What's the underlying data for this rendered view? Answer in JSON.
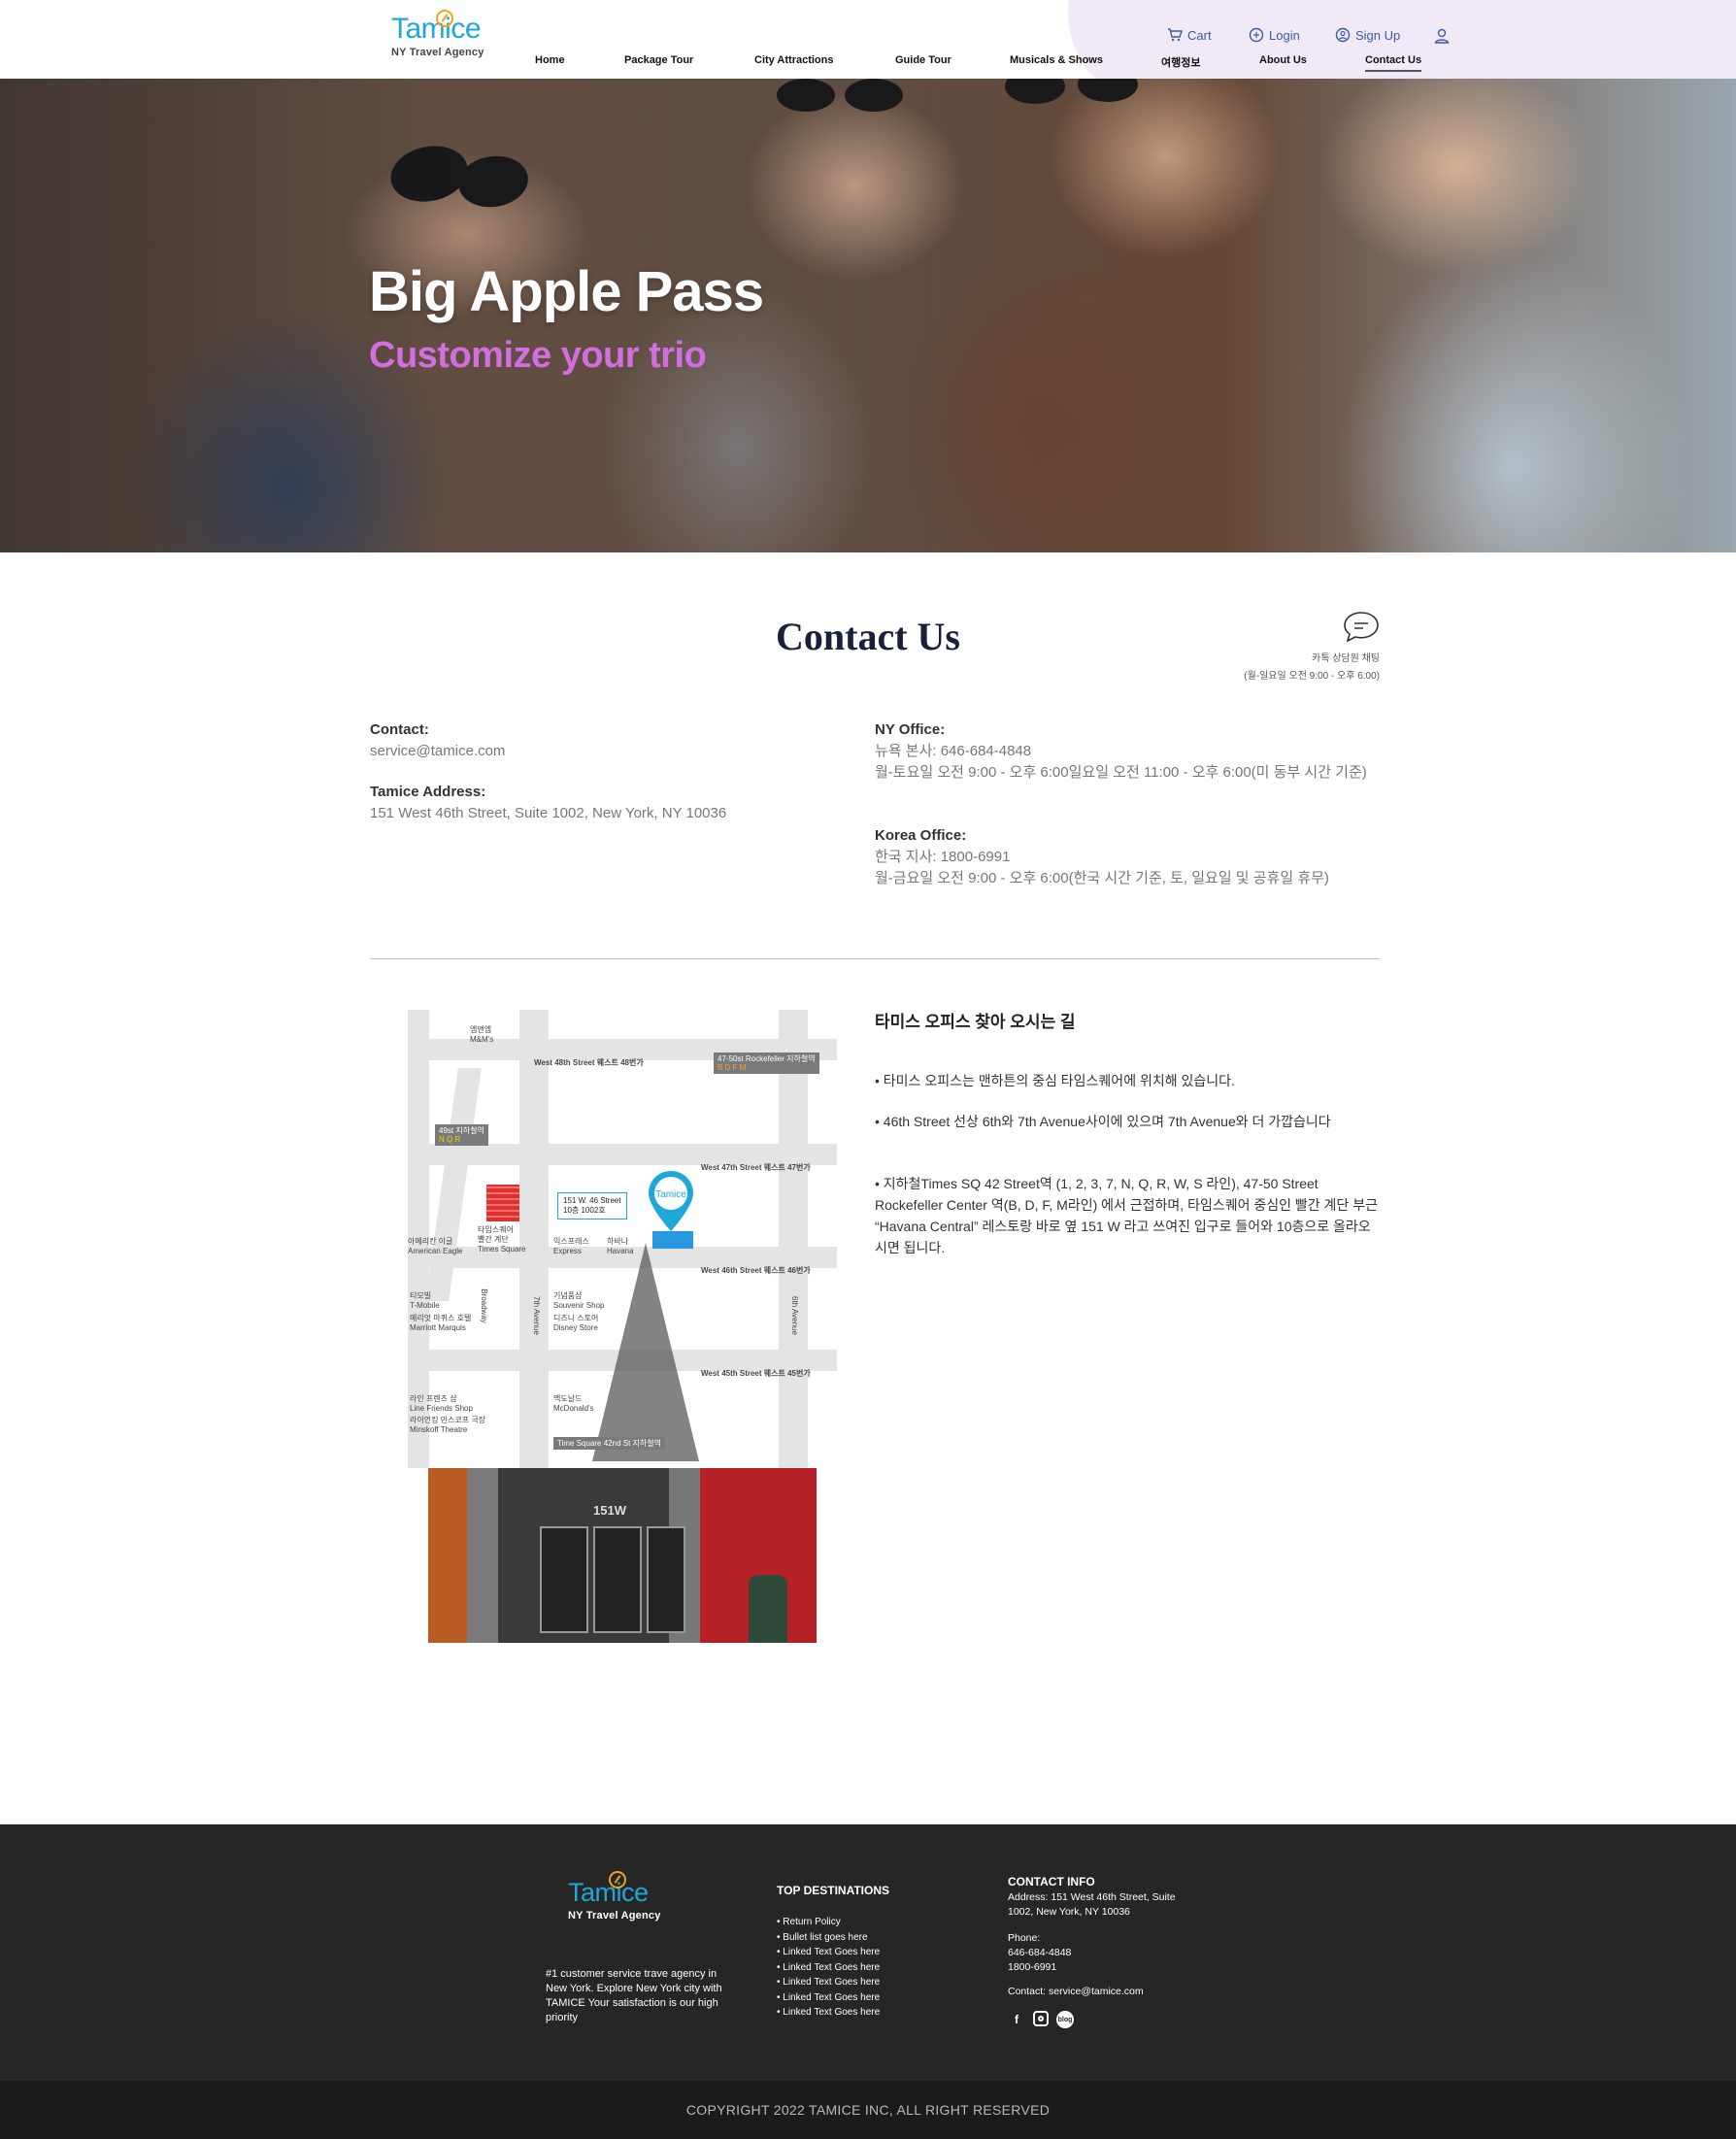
{
  "header": {
    "logo_word": "Tamice",
    "logo_tagline": "NY Travel Agency",
    "nav": [
      "Home",
      "Package Tour",
      "City Attractions",
      "Guide Tour",
      "Musicals & Shows",
      "여행정보",
      "About Us",
      "Contact Us"
    ],
    "active_nav": "Contact Us",
    "utility": {
      "cart": "Cart",
      "login": "Login",
      "signup": "Sign Up"
    },
    "accent_color": "#3b5aa8",
    "blob_color": "#f1eaf6"
  },
  "hero": {
    "title": "Big Apple Pass",
    "subtitle": "Customize your trio",
    "subtitle_color": "#d26ee0"
  },
  "contact": {
    "title": "Contact Us",
    "chat": {
      "label": "카톡 상담원 채팅",
      "hours": "(월-일요일 오전 9:00 - 오후 6:00)"
    },
    "email_label": "Contact:",
    "email": "service@tamice.com",
    "address_label": "Tamice Address:",
    "address": "151 West 46th Street, Suite 1002, New York, NY 10036",
    "ny_label": "NY Office:",
    "ny_phone": "뉴욕 본사: 646-684-4848",
    "ny_hours": "월-토요일 오전 9:00 - 오후 6:00일요일 오전 11:00 - 오후 6:00(미 동부 시간 기준)",
    "korea_label": "Korea Office:",
    "korea_phone": "한국 지사: 1800-6991",
    "korea_hours": "월-금요일 오전 9:00 - 오후 6:00(한국 시간 기준, 토, 일요일 및 공휴일 휴무)"
  },
  "map": {
    "streets": [
      "West 48th Street 웨스트 48번가",
      "West 47th Street 웨스트 47번가",
      "West 46th Street 웨스트 46번가",
      "West 45th Street 웨스트 45번가"
    ],
    "avenues": [
      "Broadway",
      "7th Avenue",
      "6th Avenue"
    ],
    "subway_rockefeller": "47-50st Rockefeller 지하철역",
    "subway_rockefeller_lines": "B D F M",
    "subway_49": "49st 지하철역",
    "subway_49_lines": "N Q R",
    "office_callout": [
      "151 W. 46 Street",
      "10층 1002호"
    ],
    "timesquare_subway": "Time Square 42nd St 지하철역",
    "landmarks": [
      [
        "엠앤엠",
        "M&M's"
      ],
      [
        "아메리칸 이글",
        "American Eagle"
      ],
      [
        "타임스퀘어",
        "빨간 계단",
        "Times Square"
      ],
      [
        "익스프레스",
        "Express"
      ],
      [
        "하바나",
        "Havana"
      ],
      [
        "티모빌",
        "T-Mobile"
      ],
      [
        "메리엇 마퀴스 호텔",
        "Marriott Marquis"
      ],
      [
        "기념품샵",
        "Souvenir Shop"
      ],
      [
        "디즈니 스토어",
        "Disney Store"
      ],
      [
        "라인 프렌즈 샵",
        "Line Friends Shop"
      ],
      [
        "라이언킹 민스코프 극장",
        "Minskoff Theatre"
      ],
      [
        "맥도날드",
        "McDonald's"
      ]
    ],
    "building_sign": "151W"
  },
  "directions": {
    "title": "타미스 오피스 찾아 오시는 길",
    "items": [
      "• 타미스 오피스는 맨하튼의 중심 타임스퀘어에 위치해 있습니다.",
      "• 46th Street 선상 6th와 7th Avenue사이에 있으며 7th Avenue와 더 가깝습니다",
      "• 지하철Times SQ 42 Street역 (1, 2, 3, 7, N, Q, R, W, S 라인), 47-50 Street Rockefeller Center 역(B, D, F, M라인) 에서 근접하며, 타임스퀘어 중심인 빨간 계단 부근 “Havana Central” 레스토랑 바로 옆 151 W 라고 쓰여진 입구로 들어와 10층으로 올라오시면 됩니다."
    ]
  },
  "footer": {
    "about": "#1 customer service trave agency in New York. Explore New York city with TAMICE Your satisfaction is our high priority",
    "destinations_title": "TOP DESTINATIONS",
    "destinations": [
      "• Return Policy",
      "• Bullet list goes here",
      "• Linked Text Goes here",
      "• Linked Text Goes here",
      "• Linked Text Goes here",
      "• Linked Text Goes here",
      "• Linked Text Goes here"
    ],
    "contact_title": "CONTACT INFO",
    "address_lines": [
      "Address: 151 West 46th Street, Suite",
      "1002, New York, NY 10036"
    ],
    "phone_label": "Phone:",
    "phones": [
      "646-684-4848",
      "1800-6991"
    ],
    "contact_line": "Contact: service@tamice.com",
    "social_icons": [
      "facebook-icon",
      "instagram-icon",
      "blog-icon"
    ],
    "copyright": "COPYRIGHT 2022 TAMICE INC, ALL RIGHT RESERVED"
  }
}
